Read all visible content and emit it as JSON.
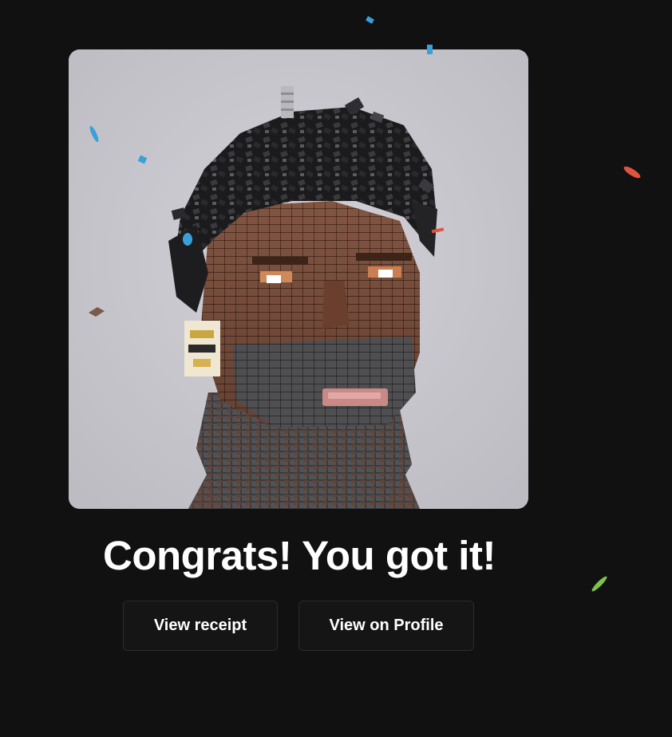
{
  "headline": "Congrats! You got it!",
  "buttons": {
    "receipt_label": "View receipt",
    "profile_label": "View on Profile"
  },
  "artwork": {
    "alt": "Voxel brick portrait artwork",
    "background_color": "#c9c8cf"
  },
  "colors": {
    "page_background": "#111111",
    "button_background": "#151515",
    "button_border": "#2b2b2b",
    "text": "#ffffff",
    "confetti": [
      "#3aa0d8",
      "#e2533f",
      "#7fc24a",
      "#7a5a48"
    ]
  }
}
